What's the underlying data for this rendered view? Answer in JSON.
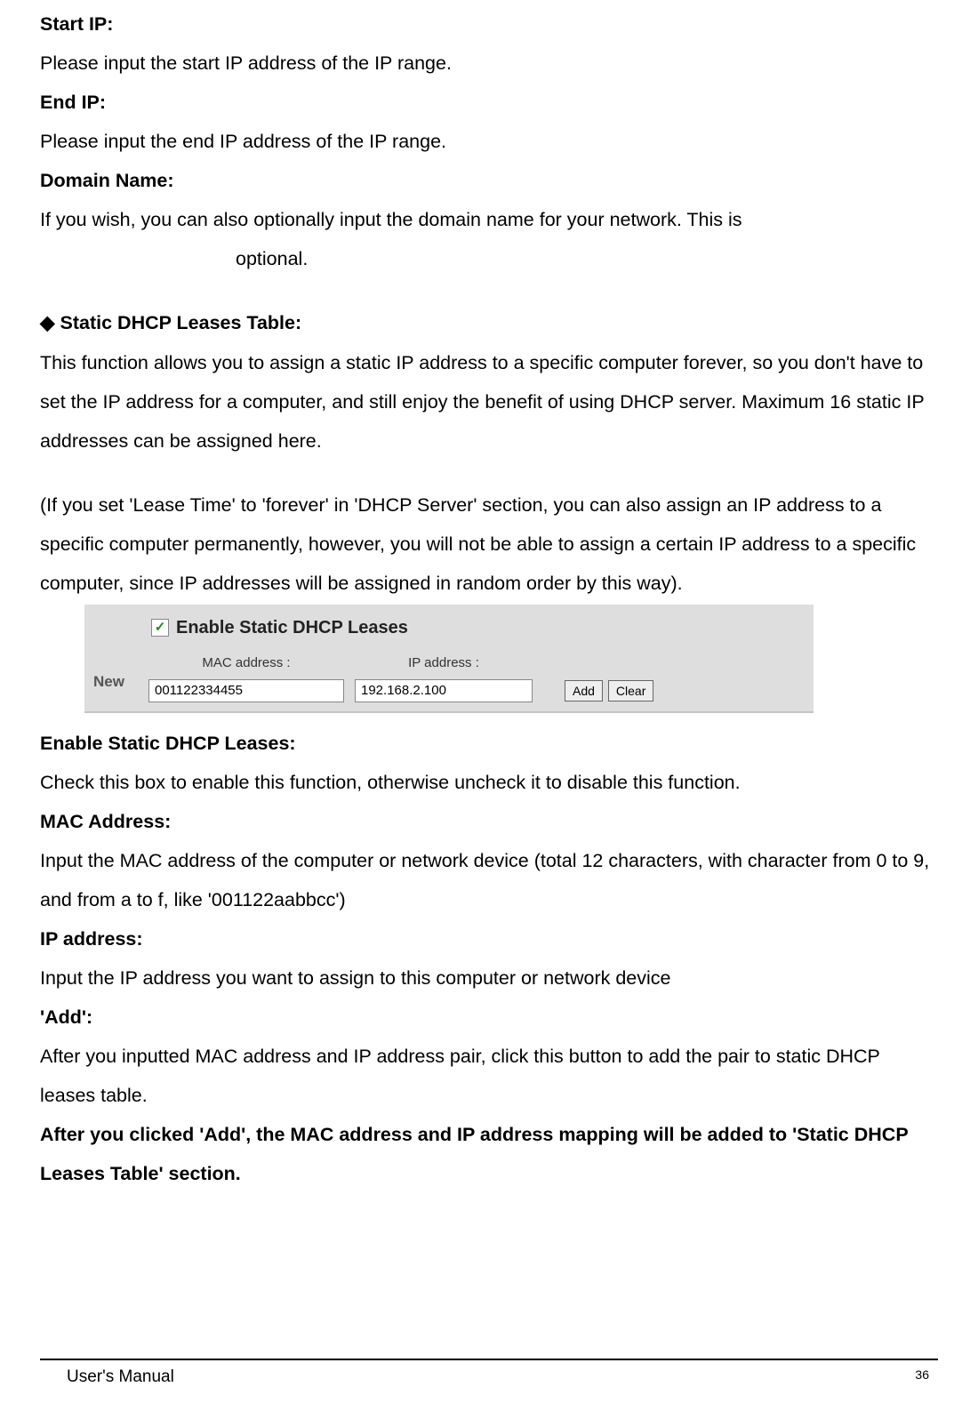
{
  "sections": {
    "start_ip": {
      "heading": "Start IP:",
      "text": "Please input the start IP address of the IP range."
    },
    "end_ip": {
      "heading": "End IP:",
      "text": "Please input the end IP address of the IP range."
    },
    "domain_name": {
      "heading": "Domain Name:",
      "text_line1": "If you wish, you can also optionally input the domain name for your network. This is",
      "text_line2": "optional."
    },
    "static_dhcp": {
      "heading": "Static DHCP Leases Table:",
      "para1": "This function allows you to assign a static IP address to a specific computer forever, so you don't have to set the IP address for a computer, and still enjoy the benefit of using DHCP server. Maximum 16 static IP addresses can be assigned here.",
      "para2": "(If you set 'Lease Time' to 'forever' in 'DHCP Server' section, you can also assign an IP address to a specific computer permanently, however, you will not be able to assign a certain IP address to a specific computer, since IP addresses will be assigned in random order by this way)."
    },
    "panel": {
      "checkbox_label": "Enable Static DHCP Leases",
      "new_label": "New",
      "mac_label": "MAC address :",
      "mac_value": "001122334455",
      "ip_label": "IP address :",
      "ip_value": "192.168.2.100",
      "add_button": "Add",
      "clear_button": "Clear"
    },
    "enable_static": {
      "heading": "Enable Static DHCP Leases:",
      "text": "Check this box to enable this function, otherwise uncheck it to disable this function."
    },
    "mac_address": {
      "heading": "MAC Address:",
      "text": "Input the MAC address of the computer or network device (total 12 characters, with character from 0 to 9, and from a to f, like '001122aabbcc')"
    },
    "ip_address": {
      "heading": "IP address:",
      "text": "Input the IP address you want to assign to this computer or network device"
    },
    "add": {
      "heading": "'Add':",
      "text": "After you inputted MAC address and IP address pair, click this button to add the pair to static DHCP leases table."
    },
    "after_add": {
      "text": "After you clicked 'Add', the MAC address and IP address mapping will be added to 'Static DHCP Leases Table' section."
    }
  },
  "footer": {
    "left": "User's Manual",
    "page": "36"
  }
}
